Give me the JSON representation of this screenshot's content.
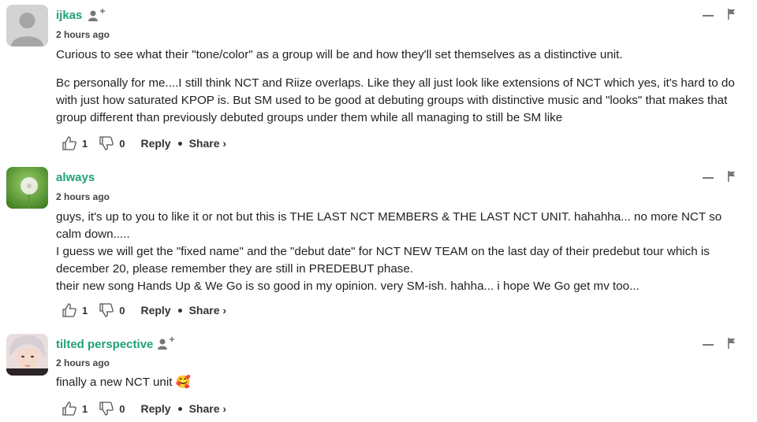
{
  "comments": [
    {
      "username": "ijkas",
      "timestamp": "2 hours ago",
      "body": [
        "Curious to see what their \"tone/color\" as a group will be and how they'll set themselves as a distinctive unit.",
        "Bc personally for me....I still think NCT and Riize overlaps. Like they all just look like extensions of NCT which yes, it's hard to do with just how saturated KPOP is. But SM used to be good at debuting groups with distinctive music and \"looks\" that makes that group different than previously debuted groups under them while all managing to still be SM like"
      ],
      "likes": "1",
      "dislikes": "0",
      "reply_label": "Reply",
      "share_label": "Share ›",
      "avatar": "default-silhouette"
    },
    {
      "username": "always",
      "timestamp": "2 hours ago",
      "body": [
        "guys, it's up to you to like it or not but this is THE LAST NCT MEMBERS & THE LAST NCT UNIT. hahahha... no more NCT so calm down.....",
        "I guess we will get the \"fixed name\" and the \"debut date\" for NCT NEW TEAM on the last day of their predebut tour which is december 20, please remember they are still in PREDEBUT phase.",
        "their new song Hands Up & We Go is so good in my opinion. very SM-ish. hahha... i hope We Go get mv too..."
      ],
      "likes": "1",
      "dislikes": "0",
      "reply_label": "Reply",
      "share_label": "Share ›",
      "avatar": "dandelion-photo"
    },
    {
      "username": "tilted perspective",
      "timestamp": "2 hours ago",
      "body": [
        "finally a new NCT unit 🥰"
      ],
      "likes": "1",
      "dislikes": "0",
      "reply_label": "Reply",
      "share_label": "Share ›",
      "avatar": "person-photo"
    }
  ],
  "colors": {
    "username": "#1fa07a",
    "text": "#222222",
    "icon": "#777777"
  },
  "icons": [
    "follow-icon",
    "minimize-icon",
    "flag-icon",
    "thumbs-up-icon",
    "thumbs-down-icon"
  ]
}
